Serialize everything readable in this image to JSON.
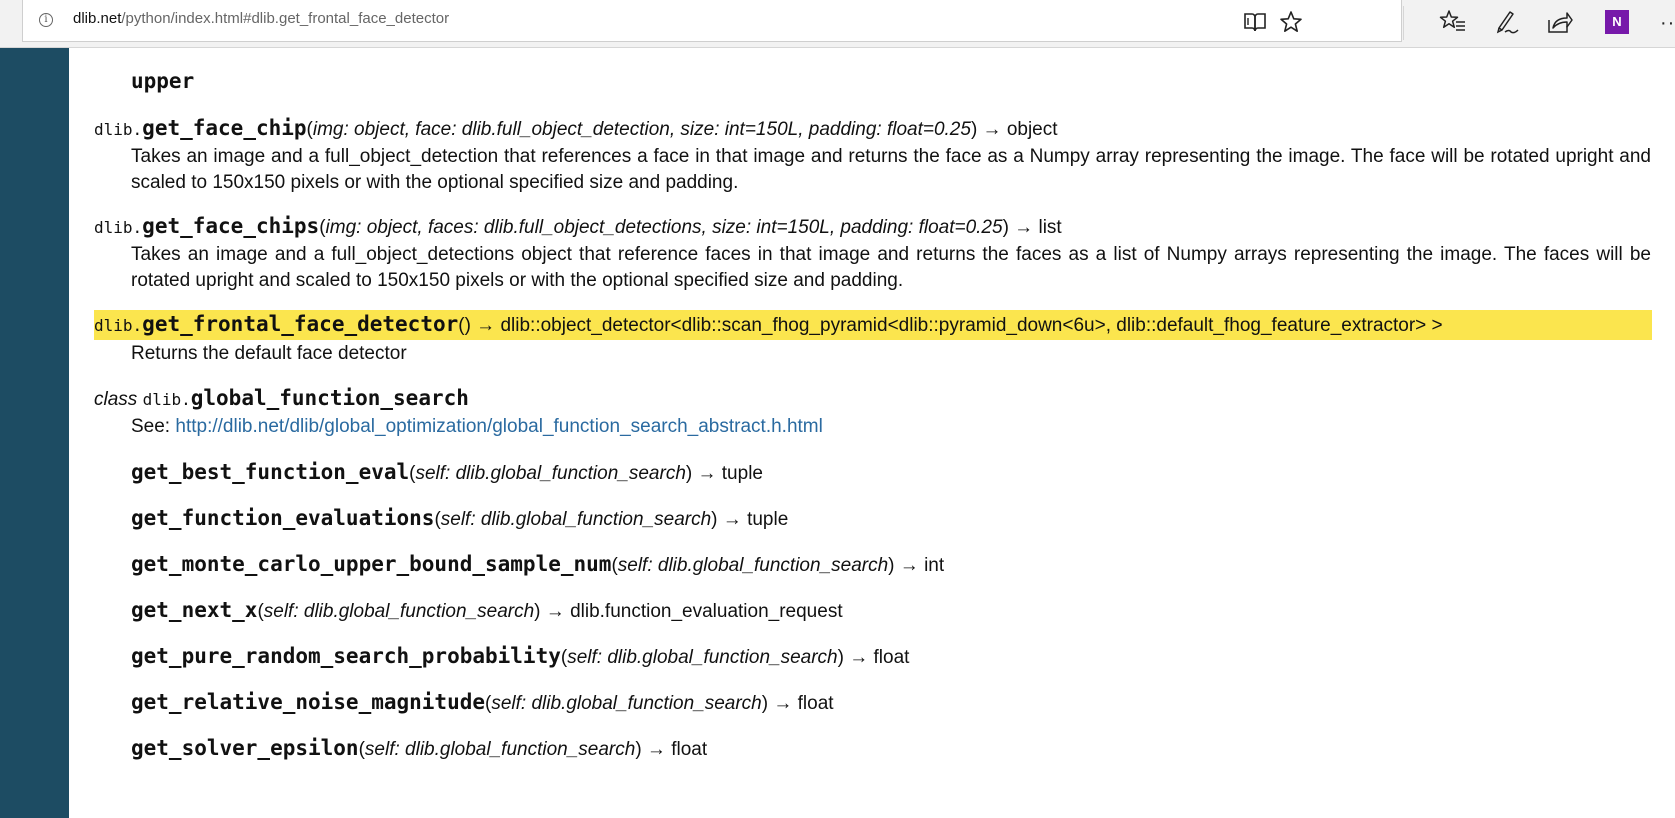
{
  "browser": {
    "url_host": "dlib.net",
    "url_path": "/python/index.html#dlib.get_frontal_face_detector",
    "onenote_label": "N"
  },
  "doc": {
    "upper": "upper",
    "prefix": "dlib.",
    "arrow": " → ",
    "face_chip": {
      "name": "get_face_chip",
      "params": "img: object, face: dlib.full_object_detection, size: int=150L, padding: float=0.25",
      "returns": "object",
      "desc": "Takes an image and a full_object_detection that references a face in that image and returns the face as a Numpy array representing the image. The face will be rotated upright and scaled to 150x150 pixels or with the optional specified size and padding."
    },
    "face_chips": {
      "name": "get_face_chips",
      "params": "img: object, faces: dlib.full_object_detections, size: int=150L, padding: float=0.25",
      "returns": "list",
      "desc": "Takes an image and a full_object_detections object that reference faces in that image and returns the faces as a list of Numpy arrays representing the image. The faces will be rotated upright and scaled to 150x150 pixels or with the optional specified size and padding."
    },
    "frontal": {
      "name": "get_frontal_face_detector",
      "params": "",
      "returns": "dlib::object_detector<dlib::scan_fhog_pyramid<dlib::pyramid_down<6u>, dlib::default_fhog_feature_extractor> >",
      "desc": "Returns the default face detector"
    },
    "gfs": {
      "class_kw": "class",
      "name": "global_function_search",
      "see_label": "See: ",
      "see_url": "http://dlib.net/dlib/global_optimization/global_function_search_abstract.h.html"
    },
    "self_param": "self: dlib.global_function_search",
    "methods": [
      {
        "name": "get_best_function_eval",
        "returns": "tuple"
      },
      {
        "name": "get_function_evaluations",
        "returns": "tuple"
      },
      {
        "name": "get_monte_carlo_upper_bound_sample_num",
        "returns": "int"
      },
      {
        "name": "get_next_x",
        "returns": "dlib.function_evaluation_request"
      },
      {
        "name": "get_pure_random_search_probability",
        "returns": "float"
      },
      {
        "name": "get_relative_noise_magnitude",
        "returns": "float"
      },
      {
        "name": "get_solver_epsilon",
        "returns": "float"
      }
    ]
  }
}
